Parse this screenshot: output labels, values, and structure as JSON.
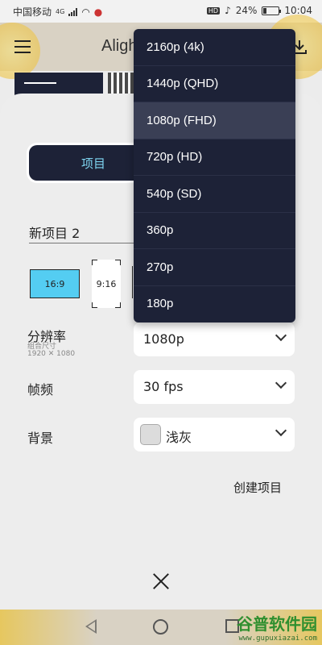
{
  "status_bar": {
    "carrier": "中国移动",
    "network": "4G",
    "battery": "24%",
    "time": "10:04",
    "hd_badge": "HD"
  },
  "app_bar": {
    "title": "Aligh"
  },
  "project_panel": {
    "tab_label": "项目",
    "project_name": "新项目 2",
    "ratios": [
      "16:9",
      "9:16"
    ],
    "resolution": {
      "label": "分辨率",
      "sub_label": "组合尺寸",
      "dimensions": "1920 ✕ 1080",
      "value": "1080p"
    },
    "frame_rate": {
      "label": "帧频",
      "value": "30 fps"
    },
    "background": {
      "label": "背景",
      "value": "浅灰",
      "swatch_color": "#dcdcdc"
    },
    "create_button": "创建项目"
  },
  "resolution_dropdown": {
    "options": [
      "2160p (4k)",
      "1440p (QHD)",
      "1080p (FHD)",
      "720p (HD)",
      "540p (SD)",
      "360p",
      "270p",
      "180p"
    ],
    "selected_index": 2
  },
  "watermark": {
    "brand": "谷普软件园",
    "url": "www.gupuxiazai.com"
  },
  "colors": {
    "dropdown_bg": "#1d2237",
    "accent_blue": "#54cdf2",
    "tab_text": "#7fd6f2"
  }
}
